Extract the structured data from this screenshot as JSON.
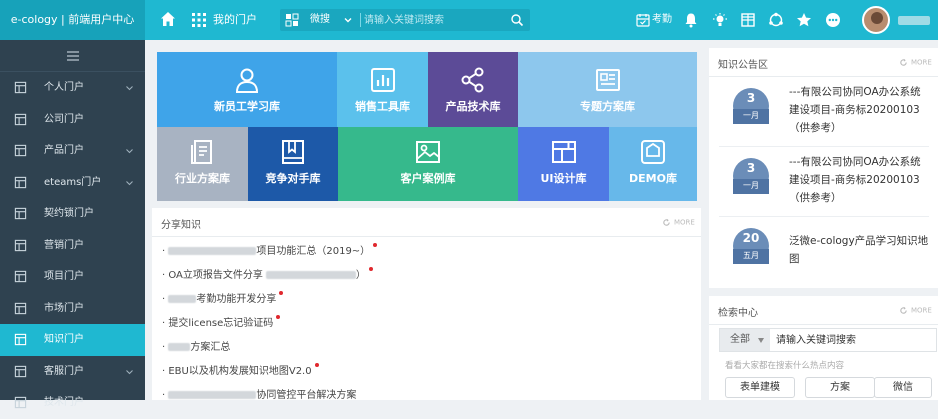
{
  "topbar": {
    "brand": "e-cology | 前端用户中心",
    "portal_label": "我的门户",
    "search_scope": "微搜",
    "search_placeholder": "请输入关键词搜索",
    "attendance_label": "考勤",
    "accent_color": "#1fb8d1",
    "icons": [
      "home-icon",
      "apps-grid-icon",
      "search-scope-icon",
      "search-icon",
      "attendance-icon",
      "bell-icon",
      "lightbulb-icon",
      "grid-icon",
      "network-icon",
      "star-icon",
      "more-icon"
    ]
  },
  "sidebar": {
    "background": "#2f4250",
    "items": [
      {
        "label": "个人门户",
        "icon": "layout-icon",
        "expandable": true
      },
      {
        "label": "公司门户",
        "icon": "layout-icon",
        "expandable": false
      },
      {
        "label": "产品门户",
        "icon": "layout-icon",
        "expandable": true
      },
      {
        "label": "eteams门户",
        "icon": "layout-icon",
        "expandable": true
      },
      {
        "label": "契约锁门户",
        "icon": "layout-icon",
        "expandable": false
      },
      {
        "label": "营销门户",
        "icon": "layout-icon",
        "expandable": false
      },
      {
        "label": "项目门户",
        "icon": "layout-icon",
        "expandable": false
      },
      {
        "label": "市场门户",
        "icon": "layout-icon",
        "expandable": false
      },
      {
        "label": "知识门户",
        "icon": "layout-icon",
        "expandable": false,
        "active": true
      },
      {
        "label": "客服门户",
        "icon": "layout-icon",
        "expandable": true
      },
      {
        "label": "技术门户",
        "icon": "layout-icon",
        "expandable": false
      }
    ]
  },
  "tiles": [
    {
      "label": "新员工学习库",
      "icon": "user-icon",
      "color": "#3fa4e9"
    },
    {
      "label": "销售工具库",
      "icon": "chart-icon",
      "color": "#5bc1ec"
    },
    {
      "label": "产品技术库",
      "icon": "share-icon",
      "color": "#5c4b97"
    },
    {
      "label": "专题方案库",
      "icon": "news-icon",
      "color": "#8dc7ed"
    },
    {
      "label": "行业方案库",
      "icon": "document-icon",
      "color": "#a8b3c2"
    },
    {
      "label": "竞争对手库",
      "icon": "book-icon",
      "color": "#1d59a8"
    },
    {
      "label": "客户案例库",
      "icon": "image-icon",
      "color": "#36b98c"
    },
    {
      "label": "UI设计库",
      "icon": "layout-icon",
      "color": "#4f79e4"
    },
    {
      "label": "DEMO库",
      "icon": "monitor-icon",
      "color": "#67b8ea"
    }
  ],
  "share": {
    "title": "分享知识",
    "more": "MORE",
    "items": [
      {
        "text": "项目功能汇总（2019~）",
        "new": true
      },
      {
        "text": "OA立项报告文件分享",
        "suffix": "）",
        "new": true
      },
      {
        "text": "考勤功能开发分享",
        "new": true
      },
      {
        "text": "提交license忘记验证码",
        "new": true
      },
      {
        "text": "方案汇总",
        "new": false
      },
      {
        "text": "EBU以及机构发展知识地图V2.0",
        "new": true
      },
      {
        "text": "协同管控平台解决方案",
        "new": false
      }
    ]
  },
  "notice": {
    "title": "知识公告区",
    "more": "MORE",
    "items": [
      {
        "day": "3",
        "month": "一月",
        "text": "---有限公司协同OA办公系统建设项目-商务标20200103（供参考）"
      },
      {
        "day": "3",
        "month": "一月",
        "text": "---有限公司协同OA办公系统建设项目-商务标20200103（供参考）"
      },
      {
        "day": "20",
        "month": "五月",
        "text": "泛微e-cology产品学习知识地图"
      }
    ]
  },
  "search_center": {
    "title": "检索中心",
    "more": "MORE",
    "scope": "全部",
    "placeholder": "请输入关键词搜索",
    "hint": "看看大家都在搜索什么热点内容",
    "buttons": [
      "表单建模",
      "方案",
      "微信"
    ]
  }
}
